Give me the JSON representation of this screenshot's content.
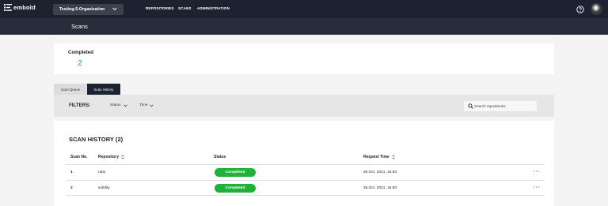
{
  "app": {
    "logo_text": "embold"
  },
  "org_selector": {
    "value": "Testing-5-Organization"
  },
  "nav": {
    "repositories": "REPOSITORIES",
    "scans": "SCANS",
    "administration": "ADMINISTRATION"
  },
  "icons": {
    "help": "help-icon",
    "avatar": "avatar",
    "search": "search-icon",
    "more": "more-icon",
    "sort": "sort-icon",
    "chevron": "chevron-down-icon"
  },
  "page": {
    "title": "Scans"
  },
  "stats": {
    "completed_label": "Completed",
    "completed_value": "2"
  },
  "tabs": {
    "queue": "Scan Queue",
    "history": "Scan History"
  },
  "filters": {
    "label": "FILTERS:",
    "status": "Status",
    "time": "Time",
    "search_placeholder": "Search repositories"
  },
  "history": {
    "title": "SCAN HISTORY (2)",
    "columns": {
      "no": "Scan No.",
      "repo": "Repository",
      "status": "Status",
      "time": "Request Time"
    },
    "rows": [
      {
        "no": "1",
        "repo": "ruby",
        "status": "Completed",
        "time": "26.Oct. 2021, 16:50"
      },
      {
        "no": "2",
        "repo": "solidity",
        "status": "Completed",
        "time": "26.Oct. 2021, 16:50"
      }
    ]
  },
  "colors": {
    "nav_bg": "#1c2230",
    "header_bg": "#272d3b",
    "success": "#1fb13a",
    "accent_text": "#29b34a"
  }
}
